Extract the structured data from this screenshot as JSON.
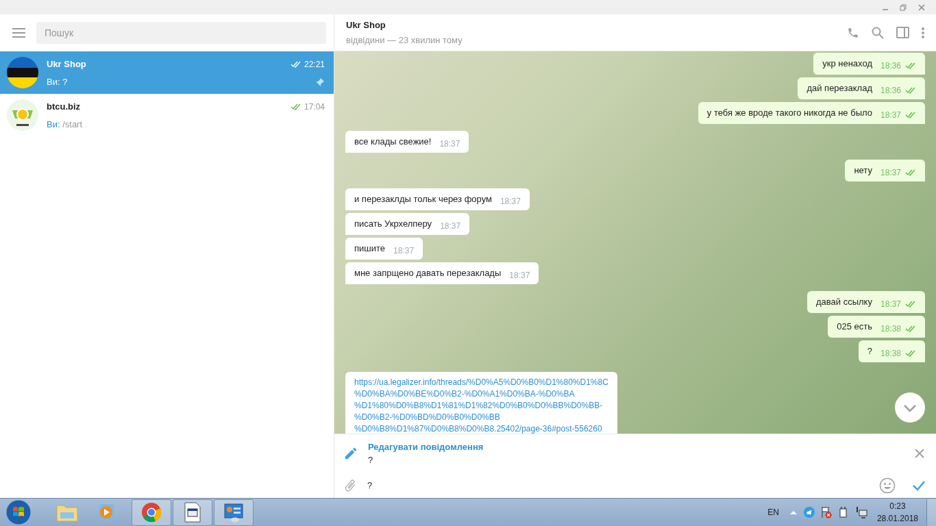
{
  "sidebar": {
    "search": {
      "placeholder": "Пошук"
    },
    "chats": [
      {
        "name": "Ukr Shop",
        "sender": "Ви:",
        "preview": " ?",
        "time": "22:21",
        "selected": true,
        "pinned": true,
        "kind": "flag"
      },
      {
        "name": "btcu.biz",
        "sender": "Ви:",
        "preview": " /start",
        "time": "17:04",
        "selected": false,
        "pinned": false,
        "kind": "coin"
      }
    ]
  },
  "chat": {
    "title": "Ukr Shop",
    "status": "відвідини — 23 хвилин тому",
    "messages": [
      {
        "out": true,
        "text": "укр ненаход",
        "time": "18:36"
      },
      {
        "out": true,
        "text": "дай перезаклад",
        "time": "18:36"
      },
      {
        "out": true,
        "text": "у тебя же вроде такого никогда не было",
        "time": "18:37"
      },
      {
        "out": false,
        "text": "все клады свежие!",
        "time": "18:37"
      },
      {
        "out": true,
        "text": "нету",
        "time": "18:37"
      },
      {
        "out": false,
        "text": "и перезаклды тольк через форум",
        "time": "18:37"
      },
      {
        "out": false,
        "text": "писать Укрхелперу",
        "time": "18:37"
      },
      {
        "out": false,
        "text": "пишите",
        "time": "18:37"
      },
      {
        "out": false,
        "text": "мне запрщено давать перезаклады",
        "time": "18:37"
      },
      {
        "out": true,
        "text": "давай ссылку",
        "time": "18:37"
      },
      {
        "out": true,
        "text": "025 есть",
        "time": "18:38"
      },
      {
        "out": true,
        "text": "?",
        "time": "18:38"
      },
      {
        "out": false,
        "kind": "link",
        "lines": [
          "https://ua.legalizer.info/threads/%D0%A5%D0%B0%D1%80%D1%8C",
          "%D0%BA%D0%BE%D0%B2-%D0%A1%D0%BA-%D0%BA",
          "%D1%80%D0%B8%D1%81%D1%82%D0%B0%D0%BB%D0%BB-",
          "%D0%B2-%D0%BD%D0%B0%D0%BB",
          "%D0%B8%D1%87%D0%B8%D0%B8.25402/page-36#post-556260"
        ]
      }
    ],
    "edit": {
      "title": "Редагувати повідомлення",
      "text": "?"
    },
    "input": {
      "value": "?"
    }
  },
  "taskbar": {
    "language": "EN",
    "time": "0:23",
    "date": "28.01.2018"
  }
}
